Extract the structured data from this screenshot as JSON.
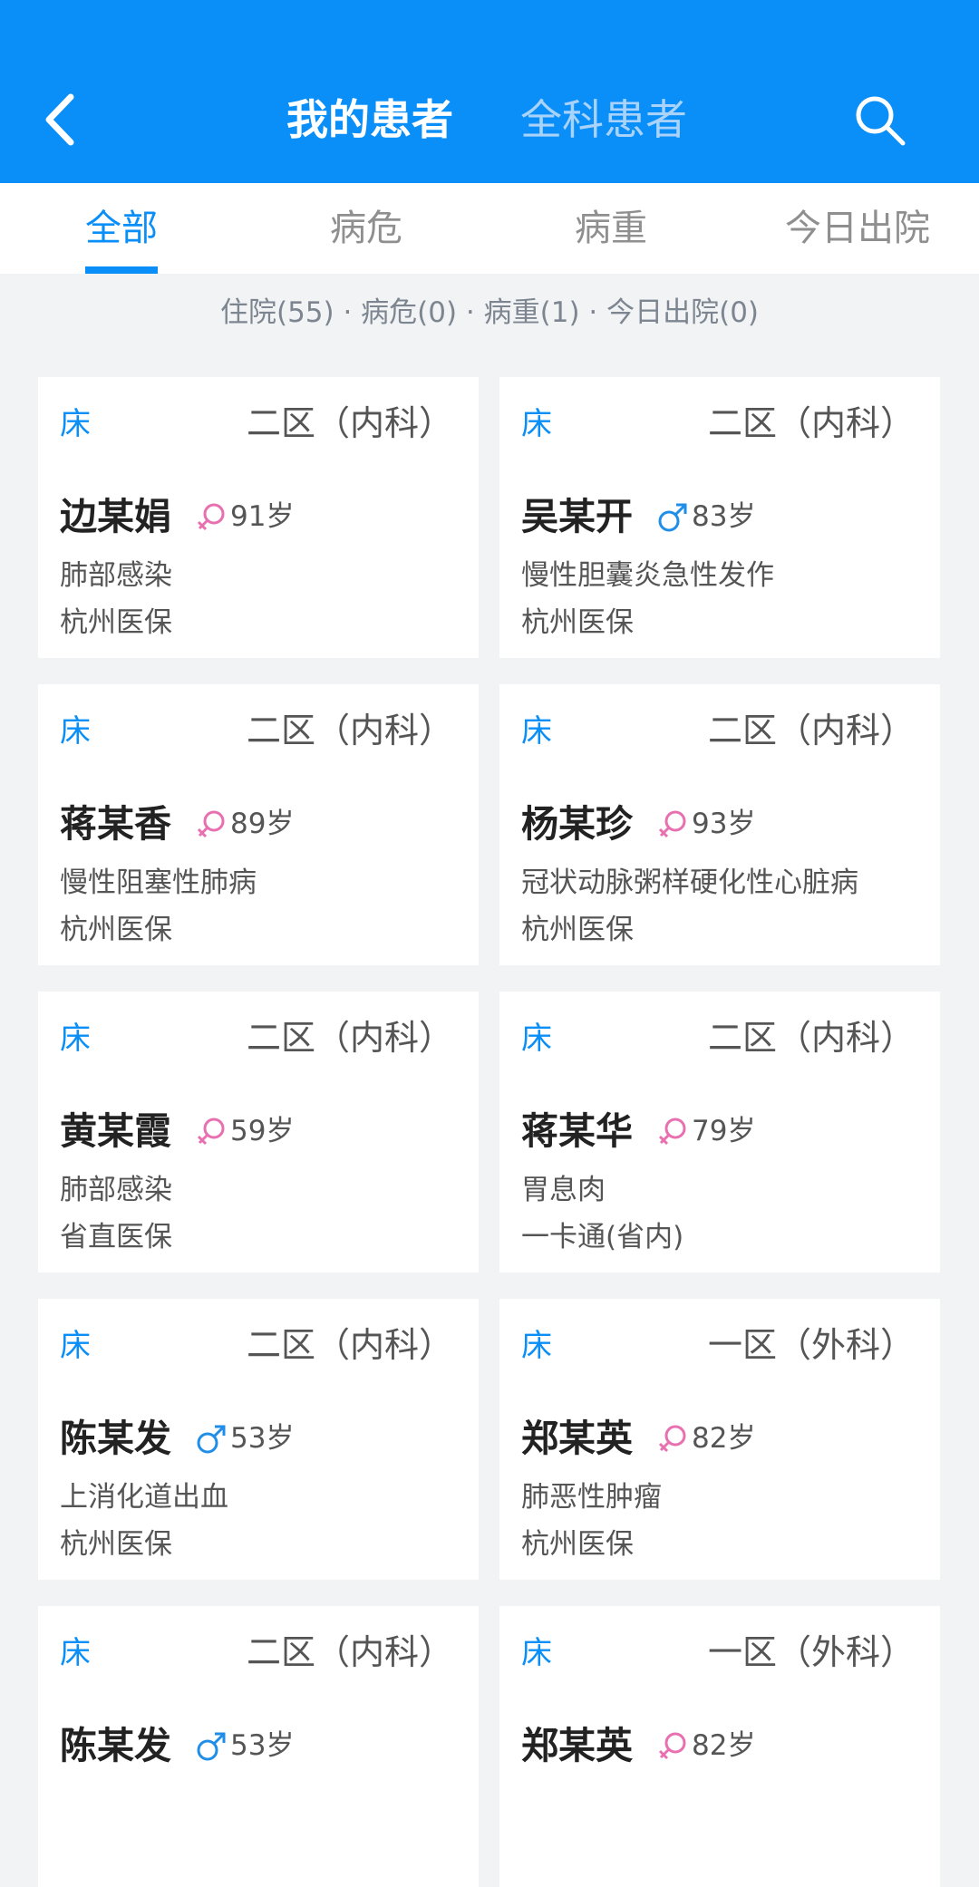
{
  "header": {
    "title_active": "我的患者",
    "title_inactive": "全科患者",
    "back_icon": "back-arrow-icon",
    "search_icon": "search-icon",
    "accent_color": "#0a8ef7"
  },
  "tabs": [
    {
      "label": "全部",
      "active": true
    },
    {
      "label": "病危",
      "active": false
    },
    {
      "label": "病重",
      "active": false
    },
    {
      "label": "今日出院",
      "active": false
    }
  ],
  "summary": "住院(55) · 病危(0) · 病重(1) · 今日出院(0)",
  "patients": [
    {
      "bed": "床",
      "ward": "二区（内科）",
      "name": "边某娟",
      "gender": "female",
      "age": "91岁",
      "diagnosis": "肺部感染",
      "insurance": "杭州医保"
    },
    {
      "bed": "床",
      "ward": "二区（内科）",
      "name": "吴某开",
      "gender": "male",
      "age": "83岁",
      "diagnosis": "慢性胆囊炎急性发作",
      "insurance": "杭州医保"
    },
    {
      "bed": "床",
      "ward": "二区（内科）",
      "name": "蒋某香",
      "gender": "female",
      "age": "89岁",
      "diagnosis": "慢性阻塞性肺病",
      "insurance": "杭州医保"
    },
    {
      "bed": "床",
      "ward": "二区（内科）",
      "name": "杨某珍",
      "gender": "female",
      "age": "93岁",
      "diagnosis": "冠状动脉粥样硬化性心脏病",
      "insurance": "杭州医保"
    },
    {
      "bed": "床",
      "ward": "二区（内科）",
      "name": "黄某霞",
      "gender": "female",
      "age": "59岁",
      "diagnosis": "肺部感染",
      "insurance": "省直医保"
    },
    {
      "bed": "床",
      "ward": "二区（内科）",
      "name": "蒋某华",
      "gender": "female",
      "age": "79岁",
      "diagnosis": "胃息肉",
      "insurance": "一卡通(省内)"
    },
    {
      "bed": "床",
      "ward": "二区（内科）",
      "name": "陈某发",
      "gender": "male",
      "age": "53岁",
      "diagnosis": "上消化道出血",
      "insurance": "杭州医保"
    },
    {
      "bed": "床",
      "ward": "一区（外科）",
      "name": "郑某英",
      "gender": "female",
      "age": "82岁",
      "diagnosis": "肺恶性肿瘤",
      "insurance": "杭州医保"
    },
    {
      "bed": "床",
      "ward": "二区（内科）",
      "name": "陈某发",
      "gender": "male",
      "age": "53岁",
      "diagnosis": "",
      "insurance": ""
    },
    {
      "bed": "床",
      "ward": "一区（外科）",
      "name": "郑某英",
      "gender": "female",
      "age": "82岁",
      "diagnosis": "",
      "insurance": ""
    }
  ],
  "colors": {
    "female": "#e86fb0",
    "male": "#1f8ee8"
  }
}
